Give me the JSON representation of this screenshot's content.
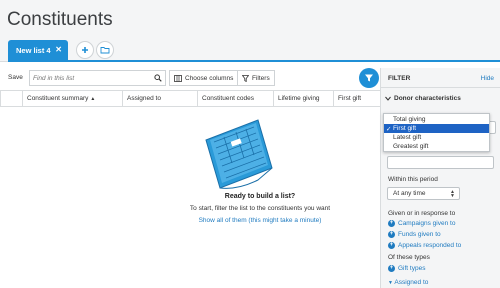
{
  "header": {
    "title": "Constituents"
  },
  "tabs": [
    {
      "label": "New list 4"
    }
  ],
  "toolbar": {
    "save_label": "Save",
    "search_placeholder": "Find in this list",
    "choose_columns_label": "Choose columns",
    "filters_label": "Filters"
  },
  "columns": [
    "Constituent summary",
    "Assigned to",
    "Constituent codes",
    "Lifetime giving",
    "First gift"
  ],
  "empty_state": {
    "title": "Ready to build a list?",
    "subtitle": "To start, filter the list to the constituents you want",
    "link": "Show all of them (this might take a minute)"
  },
  "filter_panel": {
    "title": "FILTER",
    "hide_label": "Hide",
    "section": "Donor characteristics",
    "dropdown_options": [
      {
        "label": "Total giving",
        "selected": false
      },
      {
        "label": "First gift",
        "selected": true
      },
      {
        "label": "Latest gift",
        "selected": false
      },
      {
        "label": "Greatest gift",
        "selected": false
      }
    ],
    "within_period_label": "Within this period",
    "period_value": "At any time",
    "given_label": "Given or in response to",
    "given_links": [
      "Campaigns given to",
      "Funds given to",
      "Appeals responded to"
    ],
    "types_label": "Of these types",
    "types_link": "Gift types",
    "assigned_to_label": "Assigned to"
  },
  "colors": {
    "accent": "#1f8fd6",
    "link": "#1f7bc0",
    "selected": "#1e63c4"
  },
  "icons": [
    "close-icon",
    "plus-icon",
    "folder-icon",
    "search-icon",
    "columns-icon",
    "filter-icon",
    "chevron-down-icon",
    "check-icon"
  ]
}
